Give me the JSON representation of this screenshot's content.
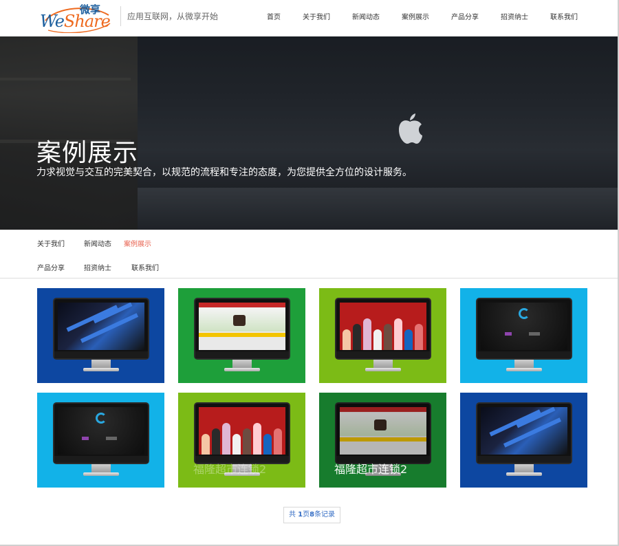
{
  "header": {
    "logo": {
      "latin_we": "We",
      "latin_share": "Share",
      "chinese": "微享"
    },
    "slogan": "应用互联网，从微享开始",
    "nav": [
      "首页",
      "关于我们",
      "新闻动态",
      "案例展示",
      "产品分享",
      "招资纳士",
      "联系我们"
    ]
  },
  "banner": {
    "title": "案例展示",
    "subtitle": "力求视觉与交互的完美契合，以规范的流程和专注的态度，为您提供全方位的设计服务。"
  },
  "subnav": {
    "items": [
      "关于我们",
      "新闻动态",
      "案例展示",
      "产品分享",
      "招资纳士",
      "联系我们"
    ],
    "active": "案例展示"
  },
  "cases": {
    "tiles": [
      {
        "bg": "#0d47a1",
        "screen": "tech",
        "caption": ""
      },
      {
        "bg": "#1e9f3a",
        "screen": "horse",
        "caption": ""
      },
      {
        "bg": "#7cbb16",
        "screen": "party",
        "caption": ""
      },
      {
        "bg": "#12b2e8",
        "screen": "dark",
        "caption": ""
      },
      {
        "bg": "#12b2e8",
        "screen": "dark",
        "caption": ""
      },
      {
        "bg": "#7cbb16",
        "screen": "party",
        "caption": "福隆超市连锁2"
      },
      {
        "bg": "#1e9f3a",
        "screen": "horse",
        "caption": "福隆超市连锁2"
      },
      {
        "bg": "#0d47a1",
        "screen": "tech",
        "caption": ""
      }
    ]
  },
  "pager": {
    "prefix": "共 ",
    "pages": "1",
    "mid": "页",
    "count": "8",
    "suffix": "条记录"
  },
  "colors": {
    "accent": "#e8624f",
    "link": "#336cc4"
  }
}
